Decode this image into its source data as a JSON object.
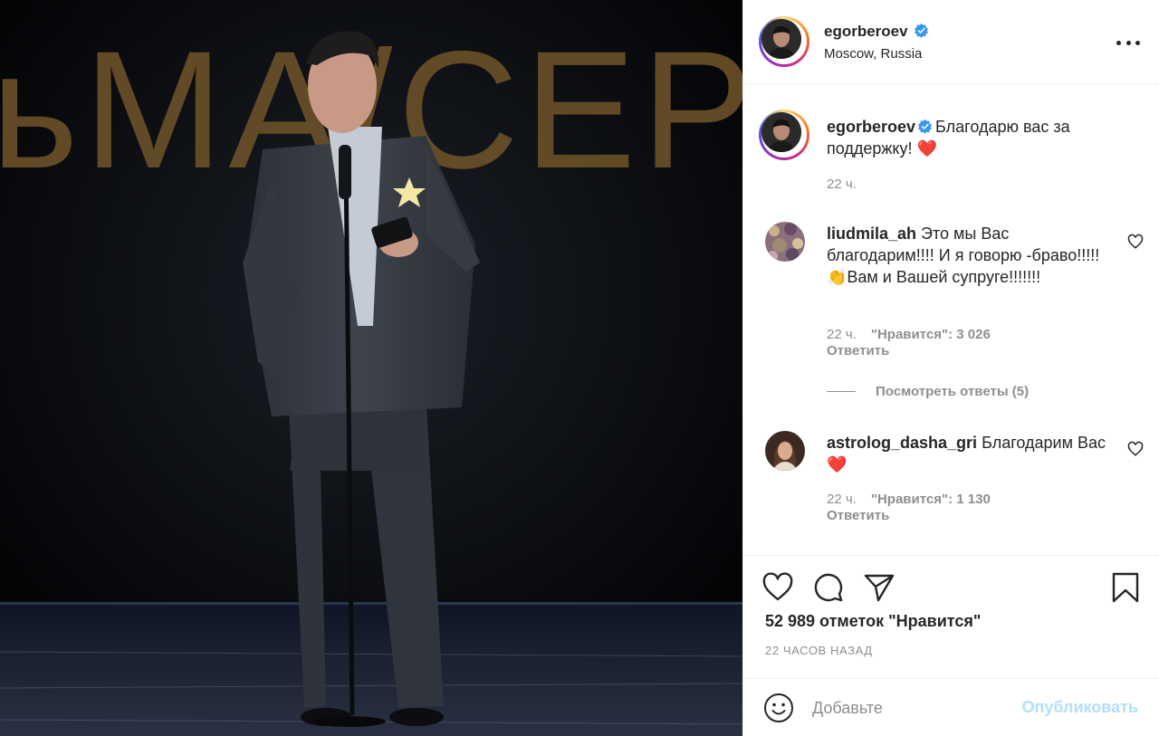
{
  "post": {
    "stage_sign_text": "ьМА/СЕРИА.",
    "header": {
      "username": "egorberoev",
      "verified": true,
      "location": "Moscow, Russia",
      "more_icon": "more-horizontal-icon"
    },
    "caption": {
      "username": "egorberoev",
      "text": "Благодарю вас за поддержку! ❤️",
      "time": "22 ч."
    },
    "comments": [
      {
        "username": "liudmila_ah",
        "text": "Это мы Вас благодарим!!!! И я говорю -браво!!!!!👏Вам и Вашей супруге!!!!!!!",
        "time": "22 ч.",
        "likes": "\"Нравится\": 3 026",
        "reply_label": "Ответить"
      },
      {
        "username": "astrolog_dasha_gri",
        "text": "Благодарим Вас ❤️",
        "time": "22 ч.",
        "likes": "\"Нравится\": 1 130",
        "reply_label": "Ответить"
      }
    ],
    "view_replies": "Посмотреть ответы (5)",
    "actions": {
      "like_icon": "heart-icon",
      "comment_icon": "comment-icon",
      "share_icon": "send-icon",
      "save_icon": "bookmark-icon"
    },
    "likes_text": "52 989 отметок \"Нравится\"",
    "time_ago": "22 ЧАСОВ НАЗАД",
    "composer": {
      "placeholder": "Добавьте",
      "publish_label": "Опубликовать"
    },
    "colors": {
      "verified": "#3897f0",
      "heart": "#ed4956",
      "publish_disabled": "#b2dffc",
      "secondary_text": "#8e8e8e"
    }
  }
}
